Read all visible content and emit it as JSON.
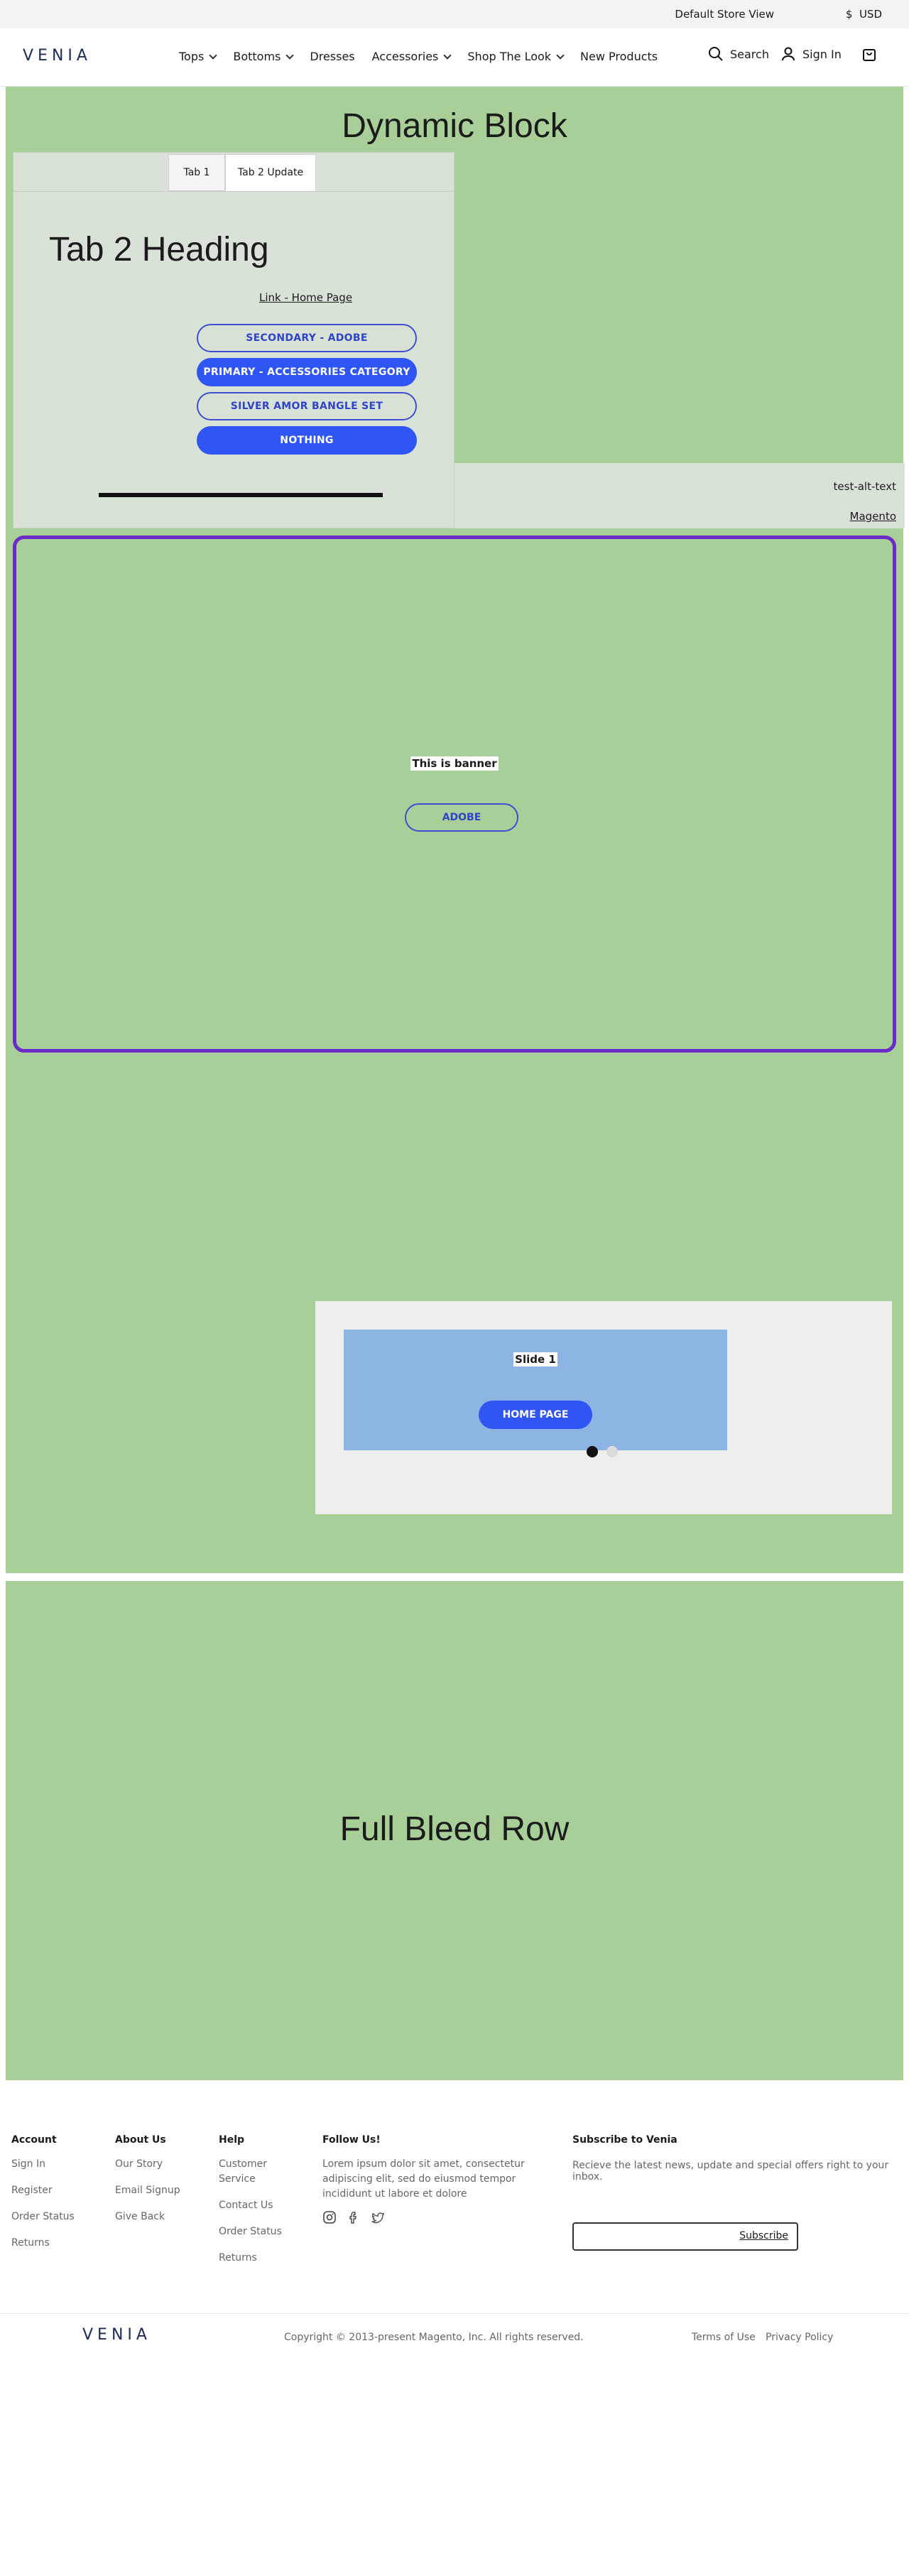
{
  "topbar": {
    "store_view": "Default Store View",
    "currency_symbol": "$",
    "currency": "USD"
  },
  "header": {
    "logo": "VENIA",
    "nav": [
      {
        "label": "Tops",
        "has_dropdown": true
      },
      {
        "label": "Bottoms",
        "has_dropdown": true
      },
      {
        "label": "Dresses",
        "has_dropdown": false
      },
      {
        "label": "Accessories",
        "has_dropdown": true
      },
      {
        "label": "Shop The Look",
        "has_dropdown": true
      },
      {
        "label": "New Products",
        "has_dropdown": false
      }
    ],
    "search_label": "Search",
    "signin_label": "Sign In"
  },
  "dynamic_block": {
    "title": "Dynamic Block",
    "tabs": [
      {
        "label": "Tab 1"
      },
      {
        "label": "Tab 2 Update",
        "active": true
      }
    ],
    "tab_heading": "Tab 2 Heading",
    "home_link": "Link - Home Page",
    "buttons": [
      {
        "label": "SECONDARY - ADOBE",
        "style": "outline"
      },
      {
        "label": "PRIMARY - ACCESSORIES CATEGORY",
        "style": "filled"
      },
      {
        "label": "SILVER AMOR BANGLE SET",
        "style": "outline"
      },
      {
        "label": "NOTHING",
        "style": "filled"
      }
    ],
    "image_alt": "test-alt-text",
    "image_link": "Magento"
  },
  "banner": {
    "text": "This is banner",
    "button": "ADOBE"
  },
  "slider": {
    "slide_title": "Slide 1",
    "slide_button": "HOME PAGE",
    "dots": 2,
    "active_dot": 1
  },
  "full_bleed": {
    "title": "Full Bleed Row"
  },
  "footer": {
    "account": {
      "heading": "Account",
      "links": [
        "Sign In",
        "Register",
        "Order Status",
        "Returns"
      ]
    },
    "about": {
      "heading": "About Us",
      "links": [
        "Our Story",
        "Email Signup",
        "Give Back"
      ]
    },
    "help": {
      "heading": "Help",
      "links": [
        "Customer Service",
        "Contact Us",
        "Order Status",
        "Returns"
      ]
    },
    "follow": {
      "heading": "Follow Us!",
      "text": "Lorem ipsum dolor sit amet, consectetur adipiscing elit, sed do eiusmod tempor incididunt ut labore et dolore",
      "icons": [
        "instagram-icon",
        "facebook-icon",
        "twitter-icon"
      ]
    },
    "subscribe": {
      "heading": "Subscribe to Venia",
      "text": "Recieve the latest news, update and special offers right to your inbox.",
      "button": "Subscribe",
      "input_value": ""
    },
    "logo": "VENIA",
    "copyright": "Copyright © 2013-present Magento, Inc. All rights reserved.",
    "terms": "Terms of Use",
    "privacy": "Privacy Policy"
  },
  "colors": {
    "green": "#a8cf97",
    "primary": "#2f55f5",
    "banner_border": "#6c2ac8",
    "slide_bg": "#8db5e3"
  }
}
